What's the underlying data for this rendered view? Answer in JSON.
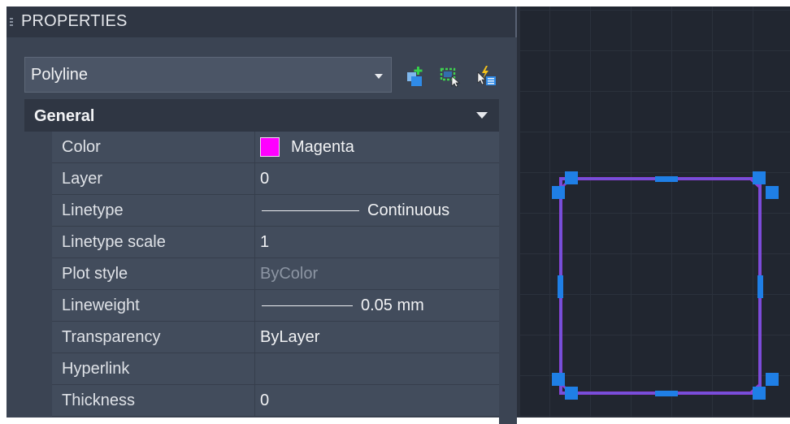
{
  "panel": {
    "title": "PROPERTIES",
    "object_type": "Polyline",
    "toolbar_icons": [
      "add-selected-icon",
      "select-objects-icon",
      "quick-select-icon"
    ]
  },
  "general": {
    "header": "General",
    "rows": [
      {
        "name": "Color",
        "value": "Magenta"
      },
      {
        "name": "Layer",
        "value": "0"
      },
      {
        "name": "Linetype",
        "value": "Continuous"
      },
      {
        "name": "Linetype scale",
        "value": "1"
      },
      {
        "name": "Plot style",
        "value": "ByColor"
      },
      {
        "name": "Lineweight",
        "value": "0.05 mm"
      },
      {
        "name": "Transparency",
        "value": "ByLayer"
      },
      {
        "name": "Hyperlink",
        "value": ""
      },
      {
        "name": "Thickness",
        "value": "0"
      }
    ]
  },
  "colors": {
    "magenta": "#ff00ff",
    "grip": "#1f7fe6",
    "polyline": "#8a3fd6"
  }
}
